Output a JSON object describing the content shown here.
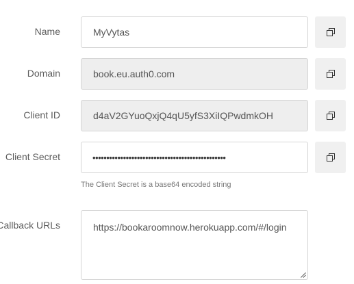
{
  "form": {
    "name": {
      "label": "Name",
      "value": "MyVytas"
    },
    "domain": {
      "label": "Domain",
      "value": "book.eu.auth0.com"
    },
    "client_id": {
      "label": "Client ID",
      "value": "d4aV2GYuoQxjQ4qU5yfS3XiIQPwdmkOH"
    },
    "client_secret": {
      "label": "Client Secret",
      "masked_value": "••••••••••••••••••••••••••••••••••••••••••••••••",
      "hint": "The Client Secret is a base64 encoded string"
    },
    "callback_urls": {
      "label": "Callback URLs",
      "value": "https://bookaroomnow.herokuapp.com/#/login"
    }
  },
  "icons": {
    "copy": "copy-icon",
    "resize": "resize-grip-icon"
  },
  "colors": {
    "readonly_background": "#eeeeee",
    "border": "#d5d5d5",
    "button_background": "#f0f0f0",
    "label_text": "#5c5c5c"
  }
}
